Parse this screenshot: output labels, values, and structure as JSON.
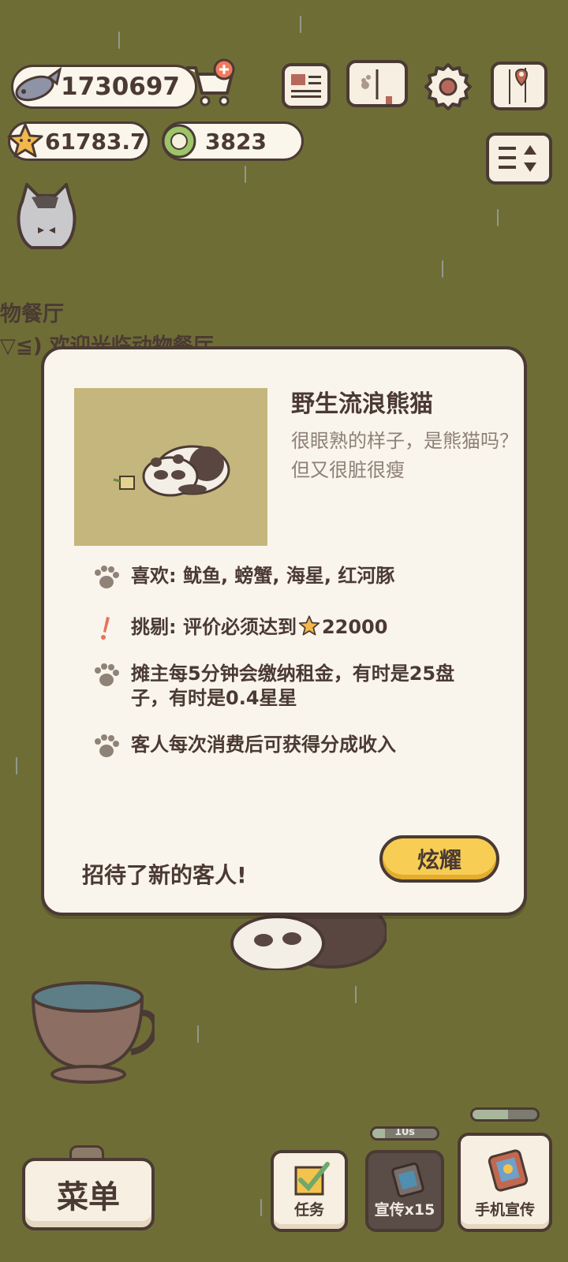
{
  "hud": {
    "fish_count": "1730697",
    "star_count": "61783.7",
    "plate_count": "3823"
  },
  "top_buttons": [
    "newspaper-icon",
    "book-icon",
    "gear-icon",
    "map-icon"
  ],
  "side": {
    "restaurant_name": "物餐厅",
    "welcome_partial": "▽≦) 欢迎光临动物餐厅"
  },
  "modal": {
    "title": "野生流浪熊猫",
    "description": "很眼熟的样子，是熊猫吗？但又很脏很瘦",
    "traits": [
      {
        "icon": "paw-icon",
        "text": "喜欢: 鱿鱼, 螃蟹, 海星, 红河豚"
      },
      {
        "icon": "exclamation-icon",
        "text_prefix": "挑剔: 评价必须达到",
        "text_value": "22000"
      },
      {
        "icon": "paw-icon",
        "text": "摊主每5分钟会缴纳租金，有时是25盘子，有时是0.4星星"
      },
      {
        "icon": "paw-icon",
        "text": "客人每次消费后可获得分成收入"
      }
    ],
    "footer_text": "招待了新的客人!",
    "show_off_button": "炫耀"
  },
  "bottom": {
    "menu_label": "菜单",
    "tasks_label": "任务",
    "promote_label": "宣传x15",
    "promote_timer": "10s",
    "phone_promote_label": "手机宣传",
    "colors": {
      "accent": "#f7cd54",
      "outline": "#4b3a34",
      "panel": "#faf5ec"
    }
  }
}
